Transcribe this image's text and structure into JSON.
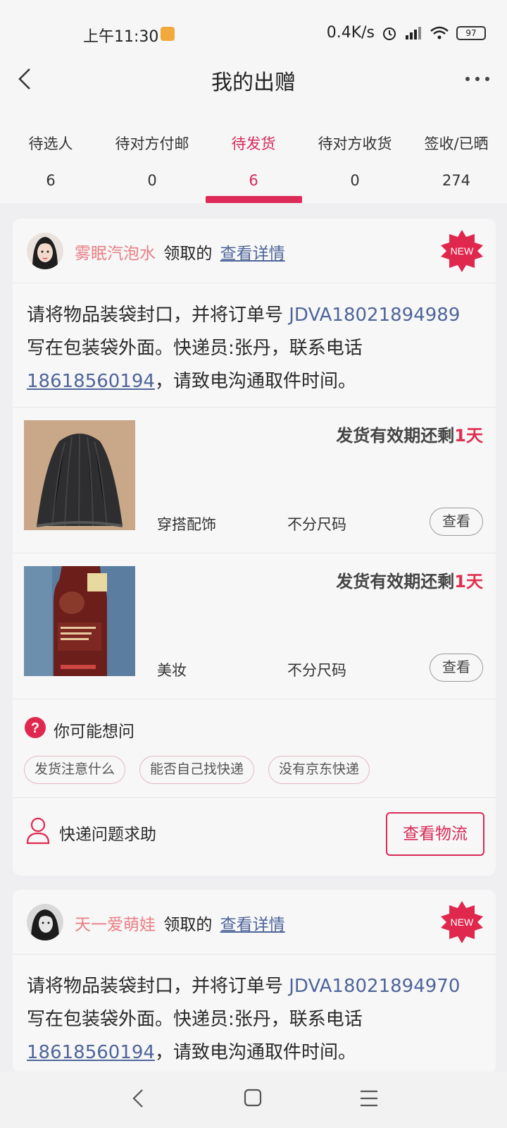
{
  "status": {
    "time": "上午11:30",
    "speed": "0.4K/s",
    "battery": "97"
  },
  "header": {
    "title": "我的出赠"
  },
  "tabs": [
    {
      "label": "待选人",
      "count": "6"
    },
    {
      "label": "待对方付邮",
      "count": "0"
    },
    {
      "label": "待发货",
      "count": "6"
    },
    {
      "label": "待对方收货",
      "count": "0"
    },
    {
      "label": "签收/已晒",
      "count": "274"
    }
  ],
  "cards": [
    {
      "user": "雾眠汽泡水",
      "claimed": "领取的",
      "detail_link": "查看详情",
      "badge": "NEW",
      "instruction_pre": "请将物品装袋封口，并将订单号 ",
      "order_no": "JDVA18021894989",
      "instruction_mid": " 写在包装袋外面。快递员:张丹，联系电话",
      "phone": "18618560194",
      "instruction_post": "，请致电沟通取件时间。",
      "items": [
        {
          "expiry_prefix": "发货有效期还剩",
          "expiry_days": "1天",
          "category": "穿搭配饰",
          "size": "不分尺码",
          "view": "查看"
        },
        {
          "expiry_prefix": "发货有效期还剩",
          "expiry_days": "1天",
          "category": "美妆",
          "size": "不分尺码",
          "view": "查看"
        }
      ],
      "faq": {
        "title": "你可能想问",
        "chips": [
          "发货注意什么",
          "能否自己找快递",
          "没有京东快递"
        ]
      },
      "help": {
        "text": "快递问题求助",
        "logistics_button": "查看物流"
      }
    },
    {
      "user": "天一爱萌娃",
      "claimed": "领取的",
      "detail_link": "查看详情",
      "badge": "NEW",
      "instruction_pre": "请将物品装袋封口，并将订单号 ",
      "order_no": "JDVA18021894970",
      "instruction_mid": " 写在包装袋外面。快递员:张丹，联系电话",
      "phone": "18618560194",
      "instruction_post": "，请致电沟通取件时间。"
    }
  ],
  "colors": {
    "accent": "#de2a57",
    "link": "#4f6599",
    "username": "#ea7f84"
  }
}
